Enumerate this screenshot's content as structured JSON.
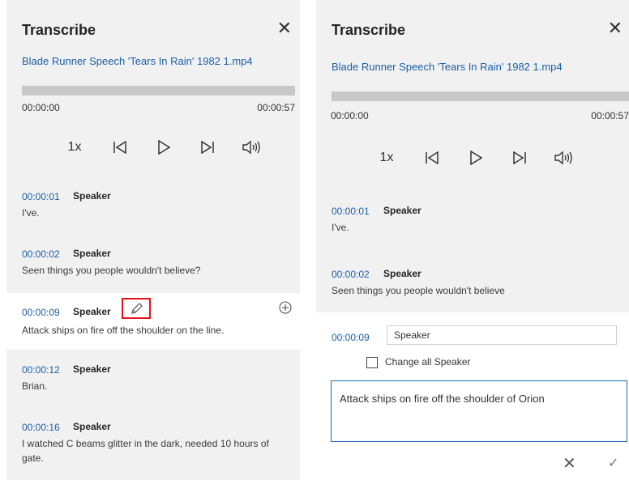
{
  "left_panel": {
    "title": "Transcribe",
    "close_glyph": "✕",
    "file_name": "Blade Runner Speech 'Tears In Rain' 1982 1.mp4",
    "time_start": "00:00:00",
    "time_end": "00:00:57",
    "speed": "1x",
    "entries": [
      {
        "time": "00:00:01",
        "speaker": "Speaker",
        "text": "I've."
      },
      {
        "time": "00:00:02",
        "speaker": "Speaker",
        "text": "Seen things you people wouldn't believe?"
      },
      {
        "time": "00:00:09",
        "speaker": "Speaker",
        "text": "Attack ships on fire off the shoulder on the line."
      },
      {
        "time": "00:00:12",
        "speaker": "Speaker",
        "text": "Brian."
      },
      {
        "time": "00:00:16",
        "speaker": "Speaker",
        "text": "I watched C beams glitter in the dark, needed 10 hours of gate."
      }
    ]
  },
  "right_panel": {
    "title": "Transcribe",
    "close_glyph": "✕",
    "file_name": "Blade Runner Speech 'Tears In Rain' 1982 1.mp4",
    "time_start": "00:00:00",
    "time_end": "00:00:57",
    "speed": "1x",
    "entries": [
      {
        "time": "00:00:01",
        "speaker": "Speaker",
        "text": "I've."
      },
      {
        "time": "00:00:02",
        "speaker": "Speaker",
        "text": "Seen things you people wouldn't believe"
      }
    ],
    "edit": {
      "time": "00:00:09",
      "speaker_value": "Speaker",
      "checkbox_label": "Change all Speaker",
      "checkbox_checked": false,
      "text_value": "Attack ships on fire off the shoulder of Orion",
      "cancel_glyph": "✕",
      "confirm_glyph": "✓"
    }
  },
  "icons": {
    "previous": "skip-previous-icon",
    "play": "play-icon",
    "next": "skip-next-icon",
    "volume": "volume-icon",
    "edit": "pencil-icon",
    "add": "plus-circle-icon"
  },
  "colors": {
    "accent": "#1b5fa8",
    "panel_bg": "#f1f1f1",
    "highlight_border": "#e8111b"
  }
}
